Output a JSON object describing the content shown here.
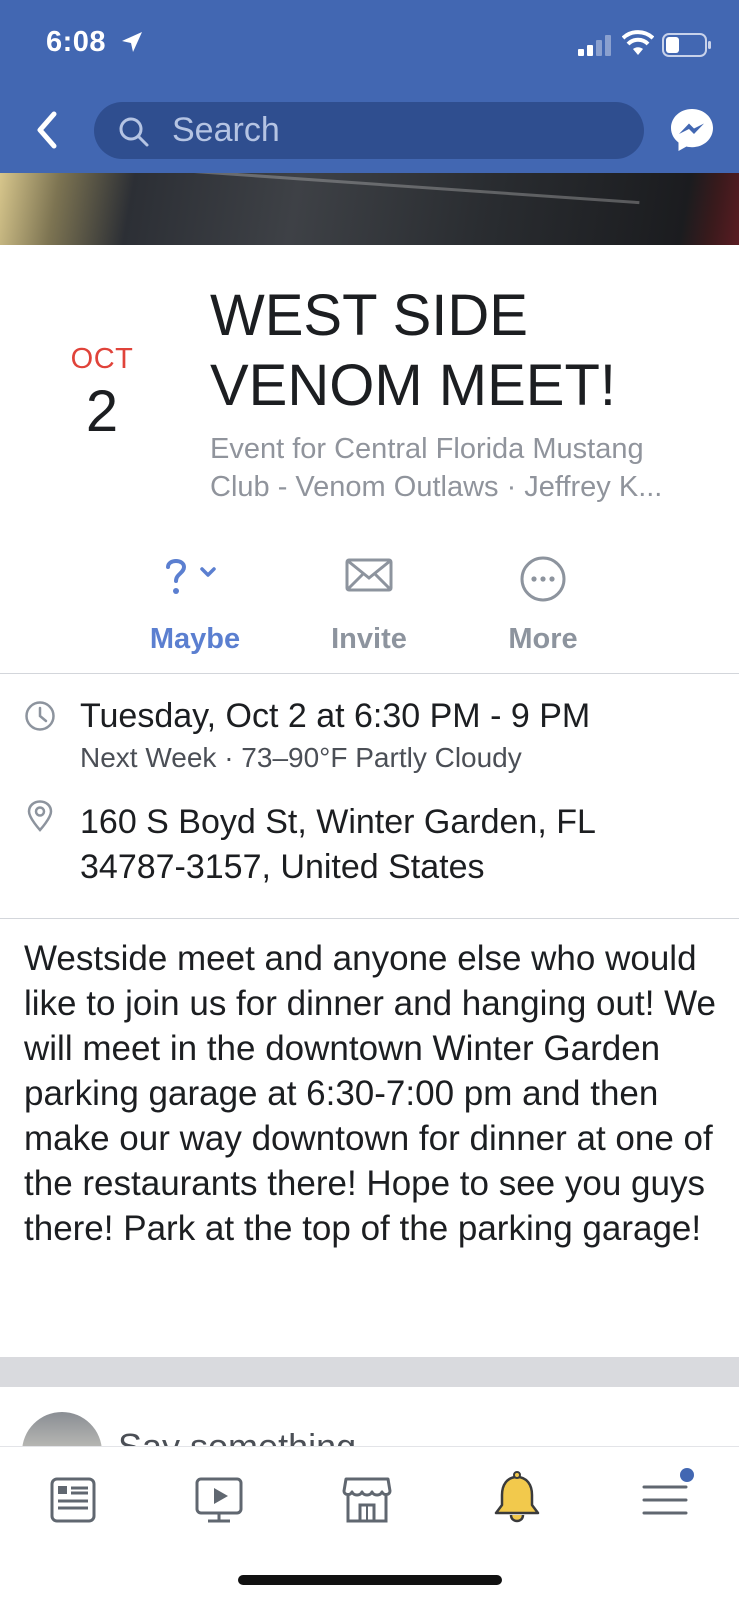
{
  "status_bar": {
    "time": "6:08"
  },
  "nav": {
    "search_placeholder": "Search"
  },
  "event": {
    "month": "OCT",
    "day": "2",
    "title": "WEST SIDE VENOM MEET!",
    "subtitle": "Event for Central Florida Mustang Club - Venom Outlaws · Jeffrey K..."
  },
  "actions": [
    {
      "label": "Maybe",
      "icon": "question-mark-icon"
    },
    {
      "label": "Invite",
      "icon": "envelope-icon"
    },
    {
      "label": "More",
      "icon": "more-dots-icon"
    }
  ],
  "details": {
    "datetime": "Tuesday, Oct 2 at 6:30 PM - 9 PM",
    "weather": "Next Week · 73–90°F Partly Cloudy",
    "address_line1": "160 S Boyd St, Winter Garden, FL",
    "address_line2": "34787-3157, United States"
  },
  "description": "Westside meet and anyone else who would like to join us for dinner and hanging out! We will meet in the downtown Winter Garden parking garage at 6:30-7:00 pm and then make our way downtown for dinner at one of the restaurants there! Hope to see you guys there! Park at the top of the parking garage!",
  "composer": {
    "prompt": "Say something..."
  },
  "tabs": [
    {
      "icon": "news-feed-icon"
    },
    {
      "icon": "watch-icon"
    },
    {
      "icon": "marketplace-icon"
    },
    {
      "icon": "notifications-bell-icon"
    },
    {
      "icon": "menu-icon"
    }
  ],
  "colors": {
    "brand": "#4267b2",
    "accent_maybe": "#5b7fd0",
    "date_red": "#e0433a",
    "bell": "#f2c94c"
  }
}
